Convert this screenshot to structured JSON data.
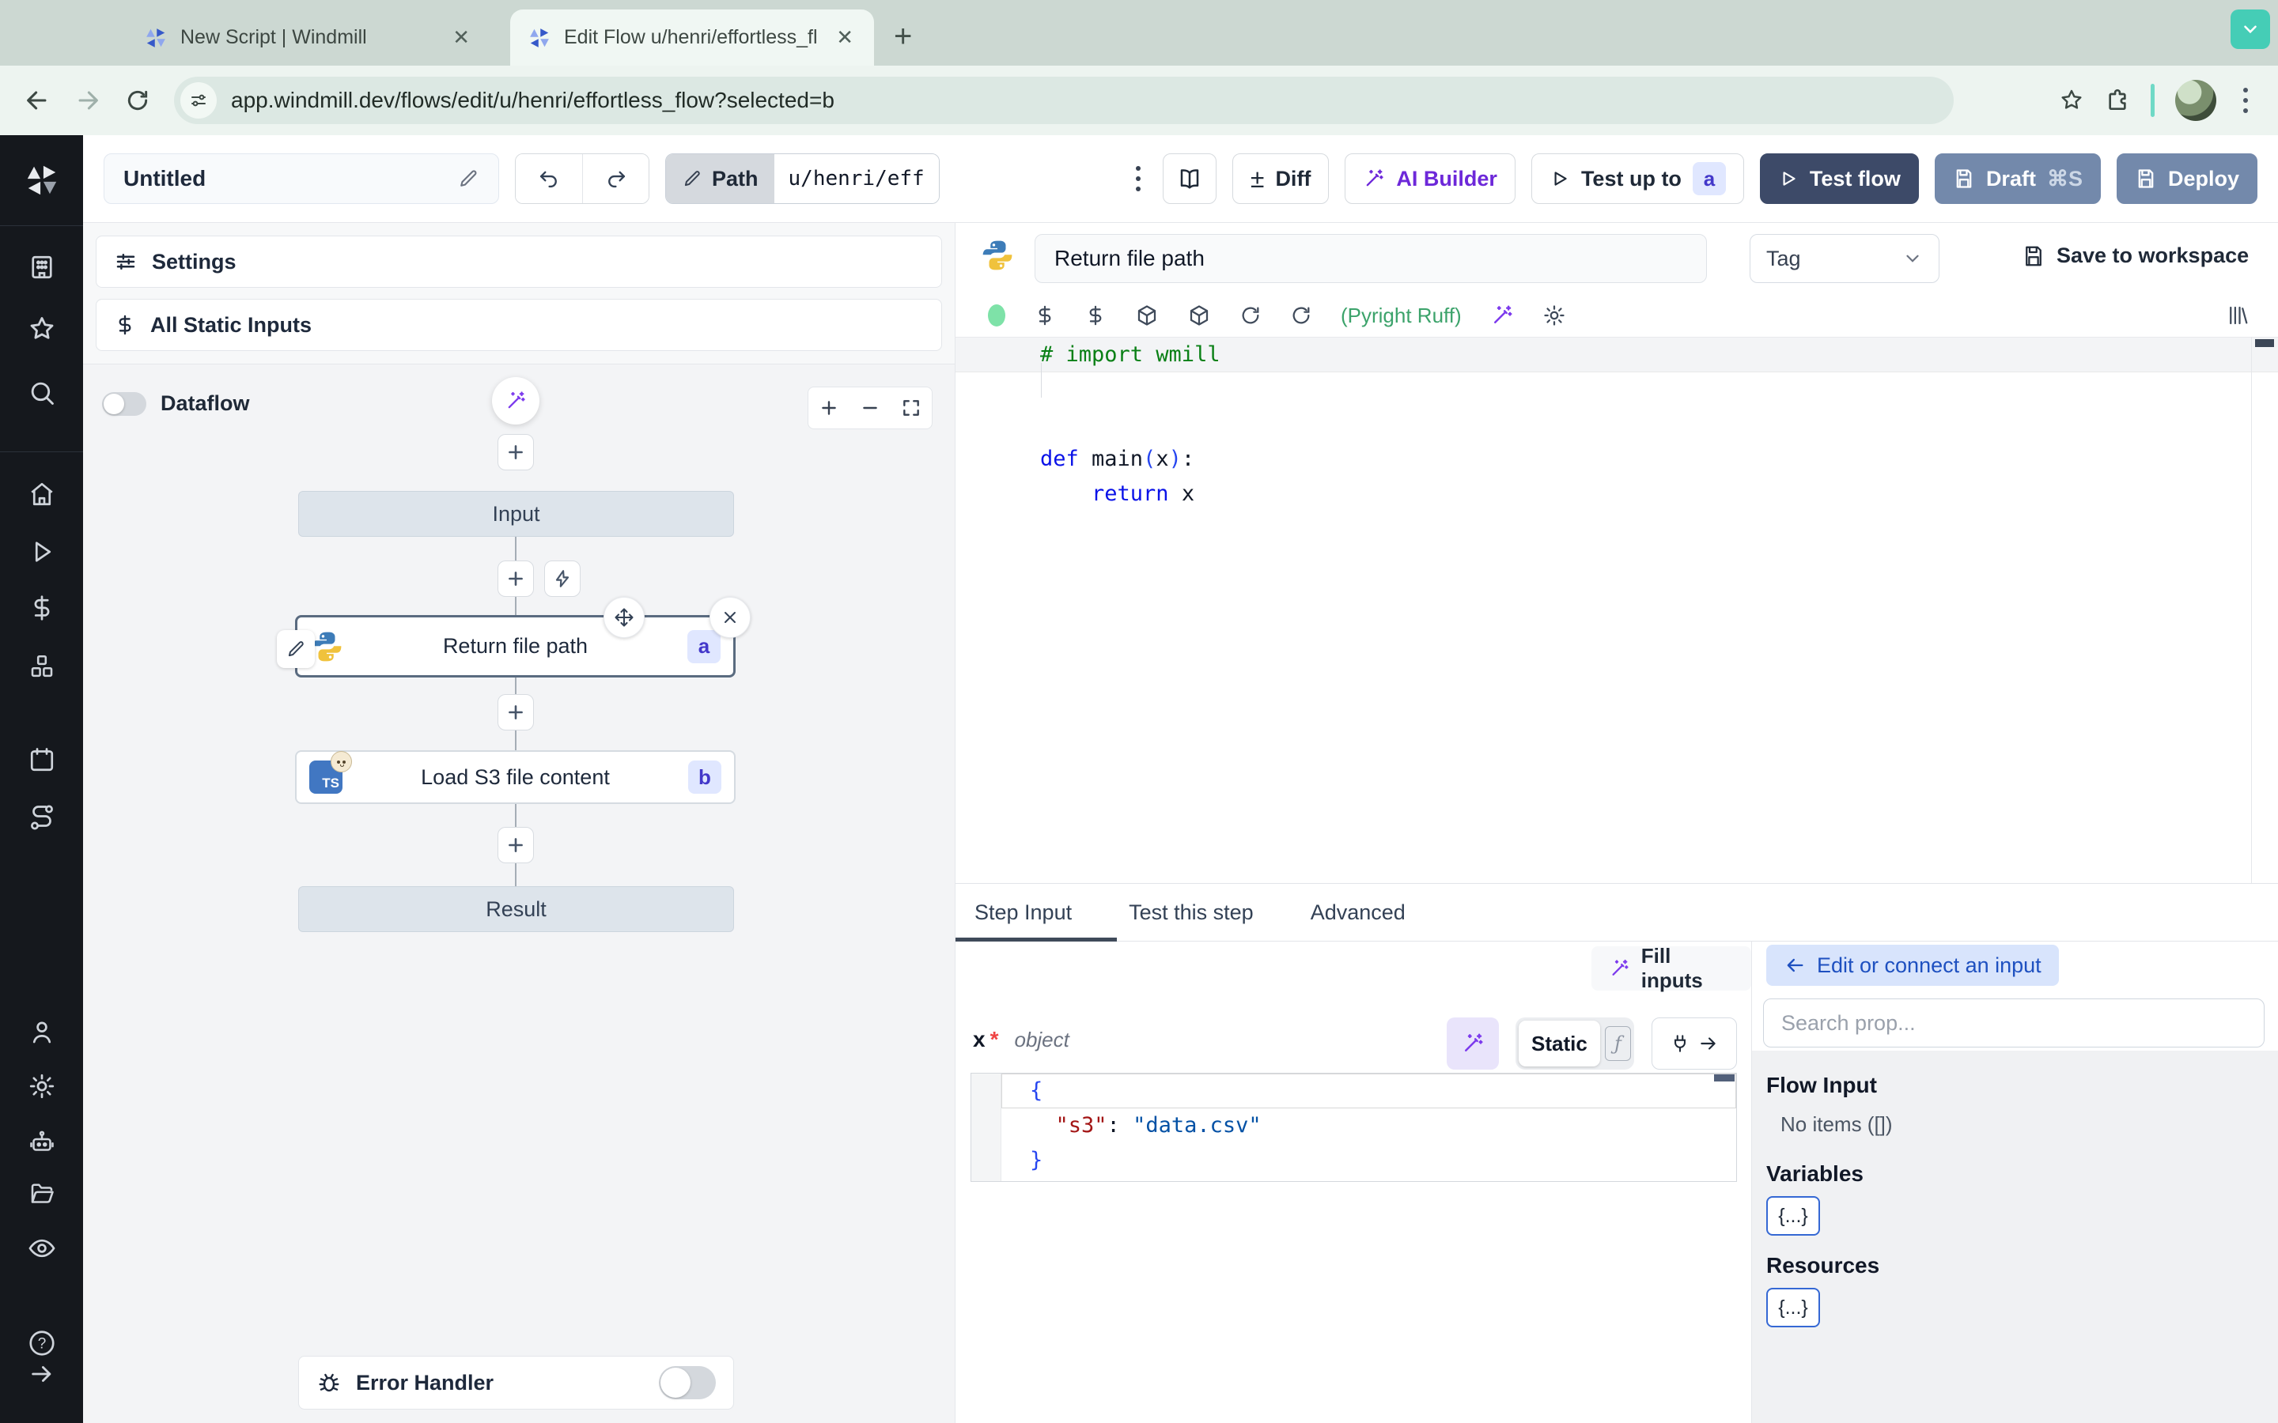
{
  "colors": {
    "accent_indigo": "#4338ca",
    "ai_purple": "#6d28d9",
    "test_flow_bg": "#3d4a68",
    "deploy_bg": "#7389ab",
    "lint_green": "#3ca36b",
    "teal_accent": "#45cdb6",
    "sidebar_bg": "#15181d"
  },
  "browser": {
    "tabs": [
      {
        "title": "New Script | Windmill"
      },
      {
        "title": "Edit Flow u/henri/effortless_fl"
      }
    ],
    "url": "app.windmill.dev/flows/edit/u/henri/effortless_flow?selected=b"
  },
  "topbar": {
    "title": "Untitled",
    "path_label": "Path",
    "path_value": "u/henri/eff",
    "diff_label": "Diff",
    "ai_builder_label": "AI Builder",
    "test_up_to_label": "Test up to",
    "test_up_to_badge": "a",
    "test_flow_label": "Test flow",
    "draft_label": "Draft",
    "draft_shortcut": "⌘S",
    "deploy_label": "Deploy"
  },
  "flow": {
    "settings_label": "Settings",
    "static_inputs_label": "All Static Inputs",
    "dataflow_label": "Dataflow",
    "input_node": "Input",
    "step_a": {
      "title": "Return file path",
      "badge": "a"
    },
    "step_b": {
      "title": "Load S3 file content",
      "badge": "b",
      "lang": "TS"
    },
    "result_node": "Result",
    "error_handler_label": "Error Handler"
  },
  "editor": {
    "step_name": "Return file path",
    "tag_placeholder": "Tag",
    "save_label": "Save to workspace",
    "lint_label": "(Pyright Ruff)",
    "code": [
      [
        [
          "c",
          "# import wmill"
        ]
      ],
      [],
      [],
      [
        [
          "k",
          "def"
        ],
        [
          "p",
          " main"
        ],
        [
          "b",
          "("
        ],
        [
          "p",
          "x"
        ],
        [
          "b",
          ")"
        ],
        [
          "p",
          ":"
        ]
      ],
      [
        [
          "p",
          "    "
        ],
        [
          "k",
          "return"
        ],
        [
          "p",
          " x"
        ]
      ]
    ]
  },
  "panel": {
    "tabs": [
      "Step Input",
      "Test this step",
      "Advanced"
    ],
    "fill_inputs_label": "Fill inputs",
    "arg_name": "x",
    "arg_required": "*",
    "arg_type": "object",
    "static_label": "Static",
    "fn_glyph": "ƒ",
    "json_code": [
      [
        [
          "b",
          "{"
        ]
      ],
      [
        [
          "p",
          "  "
        ],
        [
          "key",
          "\"s3\""
        ],
        [
          "p",
          ": "
        ],
        [
          "s",
          "\"data.csv\""
        ]
      ],
      [
        [
          "b",
          "}"
        ]
      ]
    ]
  },
  "connect": {
    "back_label": "Edit or connect an input",
    "search_placeholder": "Search prop...",
    "flow_input_title": "Flow Input",
    "flow_input_empty": "No items ([])",
    "variables_title": "Variables",
    "variables_chip": "{...}",
    "resources_title": "Resources",
    "resources_chip": "{...}"
  }
}
